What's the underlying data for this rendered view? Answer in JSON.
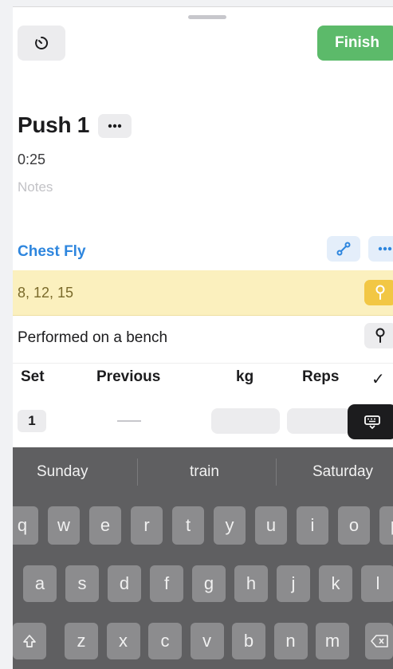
{
  "header": {
    "finish_label": "Finish"
  },
  "workout": {
    "title": "Push 1",
    "elapsed": "0:25",
    "notes_placeholder": "Notes"
  },
  "exercise": {
    "name": "Chest Fly",
    "pinned_note": "8, 12, 15",
    "note": "Performed on a bench"
  },
  "set_table": {
    "columns": {
      "set": "Set",
      "previous": "Previous",
      "kg": "kg",
      "reps": "Reps",
      "done": "✓"
    },
    "rows": [
      {
        "set": "1"
      }
    ]
  },
  "keyboard": {
    "suggestions": [
      "Sunday",
      "train",
      "Saturday"
    ],
    "row1": [
      "q",
      "w",
      "e",
      "r",
      "t",
      "y",
      "u",
      "i",
      "o",
      "p"
    ],
    "row2": [
      "a",
      "s",
      "d",
      "f",
      "g",
      "h",
      "j",
      "k",
      "l"
    ],
    "row3": [
      "z",
      "x",
      "c",
      "v",
      "b",
      "n",
      "m"
    ]
  },
  "colors": {
    "finish": "#5cba6a",
    "accent": "#2e86de",
    "note_bg": "#fbf0be",
    "pin": "#f2c744"
  }
}
